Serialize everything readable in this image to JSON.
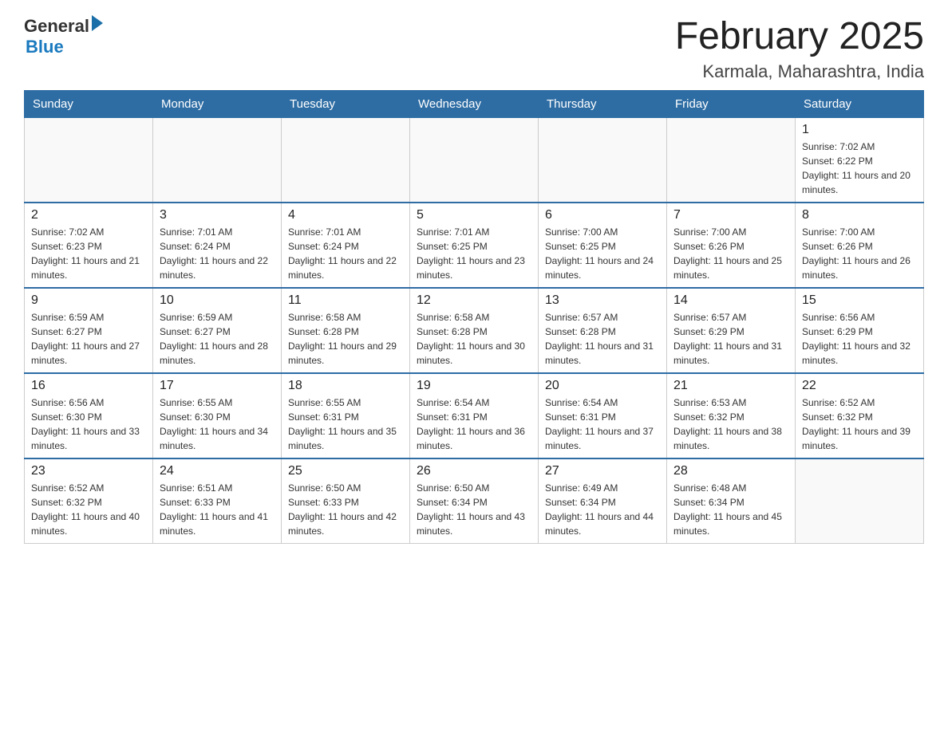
{
  "logo": {
    "general": "General",
    "blue": "Blue"
  },
  "title": "February 2025",
  "subtitle": "Karmala, Maharashtra, India",
  "days_of_week": [
    "Sunday",
    "Monday",
    "Tuesday",
    "Wednesday",
    "Thursday",
    "Friday",
    "Saturday"
  ],
  "weeks": [
    [
      {
        "day": "",
        "sunrise": "",
        "sunset": "",
        "daylight": "",
        "empty": true
      },
      {
        "day": "",
        "sunrise": "",
        "sunset": "",
        "daylight": "",
        "empty": true
      },
      {
        "day": "",
        "sunrise": "",
        "sunset": "",
        "daylight": "",
        "empty": true
      },
      {
        "day": "",
        "sunrise": "",
        "sunset": "",
        "daylight": "",
        "empty": true
      },
      {
        "day": "",
        "sunrise": "",
        "sunset": "",
        "daylight": "",
        "empty": true
      },
      {
        "day": "",
        "sunrise": "",
        "sunset": "",
        "daylight": "",
        "empty": true
      },
      {
        "day": "1",
        "sunrise": "Sunrise: 7:02 AM",
        "sunset": "Sunset: 6:22 PM",
        "daylight": "Daylight: 11 hours and 20 minutes.",
        "empty": false
      }
    ],
    [
      {
        "day": "2",
        "sunrise": "Sunrise: 7:02 AM",
        "sunset": "Sunset: 6:23 PM",
        "daylight": "Daylight: 11 hours and 21 minutes.",
        "empty": false
      },
      {
        "day": "3",
        "sunrise": "Sunrise: 7:01 AM",
        "sunset": "Sunset: 6:24 PM",
        "daylight": "Daylight: 11 hours and 22 minutes.",
        "empty": false
      },
      {
        "day": "4",
        "sunrise": "Sunrise: 7:01 AM",
        "sunset": "Sunset: 6:24 PM",
        "daylight": "Daylight: 11 hours and 22 minutes.",
        "empty": false
      },
      {
        "day": "5",
        "sunrise": "Sunrise: 7:01 AM",
        "sunset": "Sunset: 6:25 PM",
        "daylight": "Daylight: 11 hours and 23 minutes.",
        "empty": false
      },
      {
        "day": "6",
        "sunrise": "Sunrise: 7:00 AM",
        "sunset": "Sunset: 6:25 PM",
        "daylight": "Daylight: 11 hours and 24 minutes.",
        "empty": false
      },
      {
        "day": "7",
        "sunrise": "Sunrise: 7:00 AM",
        "sunset": "Sunset: 6:26 PM",
        "daylight": "Daylight: 11 hours and 25 minutes.",
        "empty": false
      },
      {
        "day": "8",
        "sunrise": "Sunrise: 7:00 AM",
        "sunset": "Sunset: 6:26 PM",
        "daylight": "Daylight: 11 hours and 26 minutes.",
        "empty": false
      }
    ],
    [
      {
        "day": "9",
        "sunrise": "Sunrise: 6:59 AM",
        "sunset": "Sunset: 6:27 PM",
        "daylight": "Daylight: 11 hours and 27 minutes.",
        "empty": false
      },
      {
        "day": "10",
        "sunrise": "Sunrise: 6:59 AM",
        "sunset": "Sunset: 6:27 PM",
        "daylight": "Daylight: 11 hours and 28 minutes.",
        "empty": false
      },
      {
        "day": "11",
        "sunrise": "Sunrise: 6:58 AM",
        "sunset": "Sunset: 6:28 PM",
        "daylight": "Daylight: 11 hours and 29 minutes.",
        "empty": false
      },
      {
        "day": "12",
        "sunrise": "Sunrise: 6:58 AM",
        "sunset": "Sunset: 6:28 PM",
        "daylight": "Daylight: 11 hours and 30 minutes.",
        "empty": false
      },
      {
        "day": "13",
        "sunrise": "Sunrise: 6:57 AM",
        "sunset": "Sunset: 6:28 PM",
        "daylight": "Daylight: 11 hours and 31 minutes.",
        "empty": false
      },
      {
        "day": "14",
        "sunrise": "Sunrise: 6:57 AM",
        "sunset": "Sunset: 6:29 PM",
        "daylight": "Daylight: 11 hours and 31 minutes.",
        "empty": false
      },
      {
        "day": "15",
        "sunrise": "Sunrise: 6:56 AM",
        "sunset": "Sunset: 6:29 PM",
        "daylight": "Daylight: 11 hours and 32 minutes.",
        "empty": false
      }
    ],
    [
      {
        "day": "16",
        "sunrise": "Sunrise: 6:56 AM",
        "sunset": "Sunset: 6:30 PM",
        "daylight": "Daylight: 11 hours and 33 minutes.",
        "empty": false
      },
      {
        "day": "17",
        "sunrise": "Sunrise: 6:55 AM",
        "sunset": "Sunset: 6:30 PM",
        "daylight": "Daylight: 11 hours and 34 minutes.",
        "empty": false
      },
      {
        "day": "18",
        "sunrise": "Sunrise: 6:55 AM",
        "sunset": "Sunset: 6:31 PM",
        "daylight": "Daylight: 11 hours and 35 minutes.",
        "empty": false
      },
      {
        "day": "19",
        "sunrise": "Sunrise: 6:54 AM",
        "sunset": "Sunset: 6:31 PM",
        "daylight": "Daylight: 11 hours and 36 minutes.",
        "empty": false
      },
      {
        "day": "20",
        "sunrise": "Sunrise: 6:54 AM",
        "sunset": "Sunset: 6:31 PM",
        "daylight": "Daylight: 11 hours and 37 minutes.",
        "empty": false
      },
      {
        "day": "21",
        "sunrise": "Sunrise: 6:53 AM",
        "sunset": "Sunset: 6:32 PM",
        "daylight": "Daylight: 11 hours and 38 minutes.",
        "empty": false
      },
      {
        "day": "22",
        "sunrise": "Sunrise: 6:52 AM",
        "sunset": "Sunset: 6:32 PM",
        "daylight": "Daylight: 11 hours and 39 minutes.",
        "empty": false
      }
    ],
    [
      {
        "day": "23",
        "sunrise": "Sunrise: 6:52 AM",
        "sunset": "Sunset: 6:32 PM",
        "daylight": "Daylight: 11 hours and 40 minutes.",
        "empty": false
      },
      {
        "day": "24",
        "sunrise": "Sunrise: 6:51 AM",
        "sunset": "Sunset: 6:33 PM",
        "daylight": "Daylight: 11 hours and 41 minutes.",
        "empty": false
      },
      {
        "day": "25",
        "sunrise": "Sunrise: 6:50 AM",
        "sunset": "Sunset: 6:33 PM",
        "daylight": "Daylight: 11 hours and 42 minutes.",
        "empty": false
      },
      {
        "day": "26",
        "sunrise": "Sunrise: 6:50 AM",
        "sunset": "Sunset: 6:34 PM",
        "daylight": "Daylight: 11 hours and 43 minutes.",
        "empty": false
      },
      {
        "day": "27",
        "sunrise": "Sunrise: 6:49 AM",
        "sunset": "Sunset: 6:34 PM",
        "daylight": "Daylight: 11 hours and 44 minutes.",
        "empty": false
      },
      {
        "day": "28",
        "sunrise": "Sunrise: 6:48 AM",
        "sunset": "Sunset: 6:34 PM",
        "daylight": "Daylight: 11 hours and 45 minutes.",
        "empty": false
      },
      {
        "day": "",
        "sunrise": "",
        "sunset": "",
        "daylight": "",
        "empty": true
      }
    ]
  ]
}
